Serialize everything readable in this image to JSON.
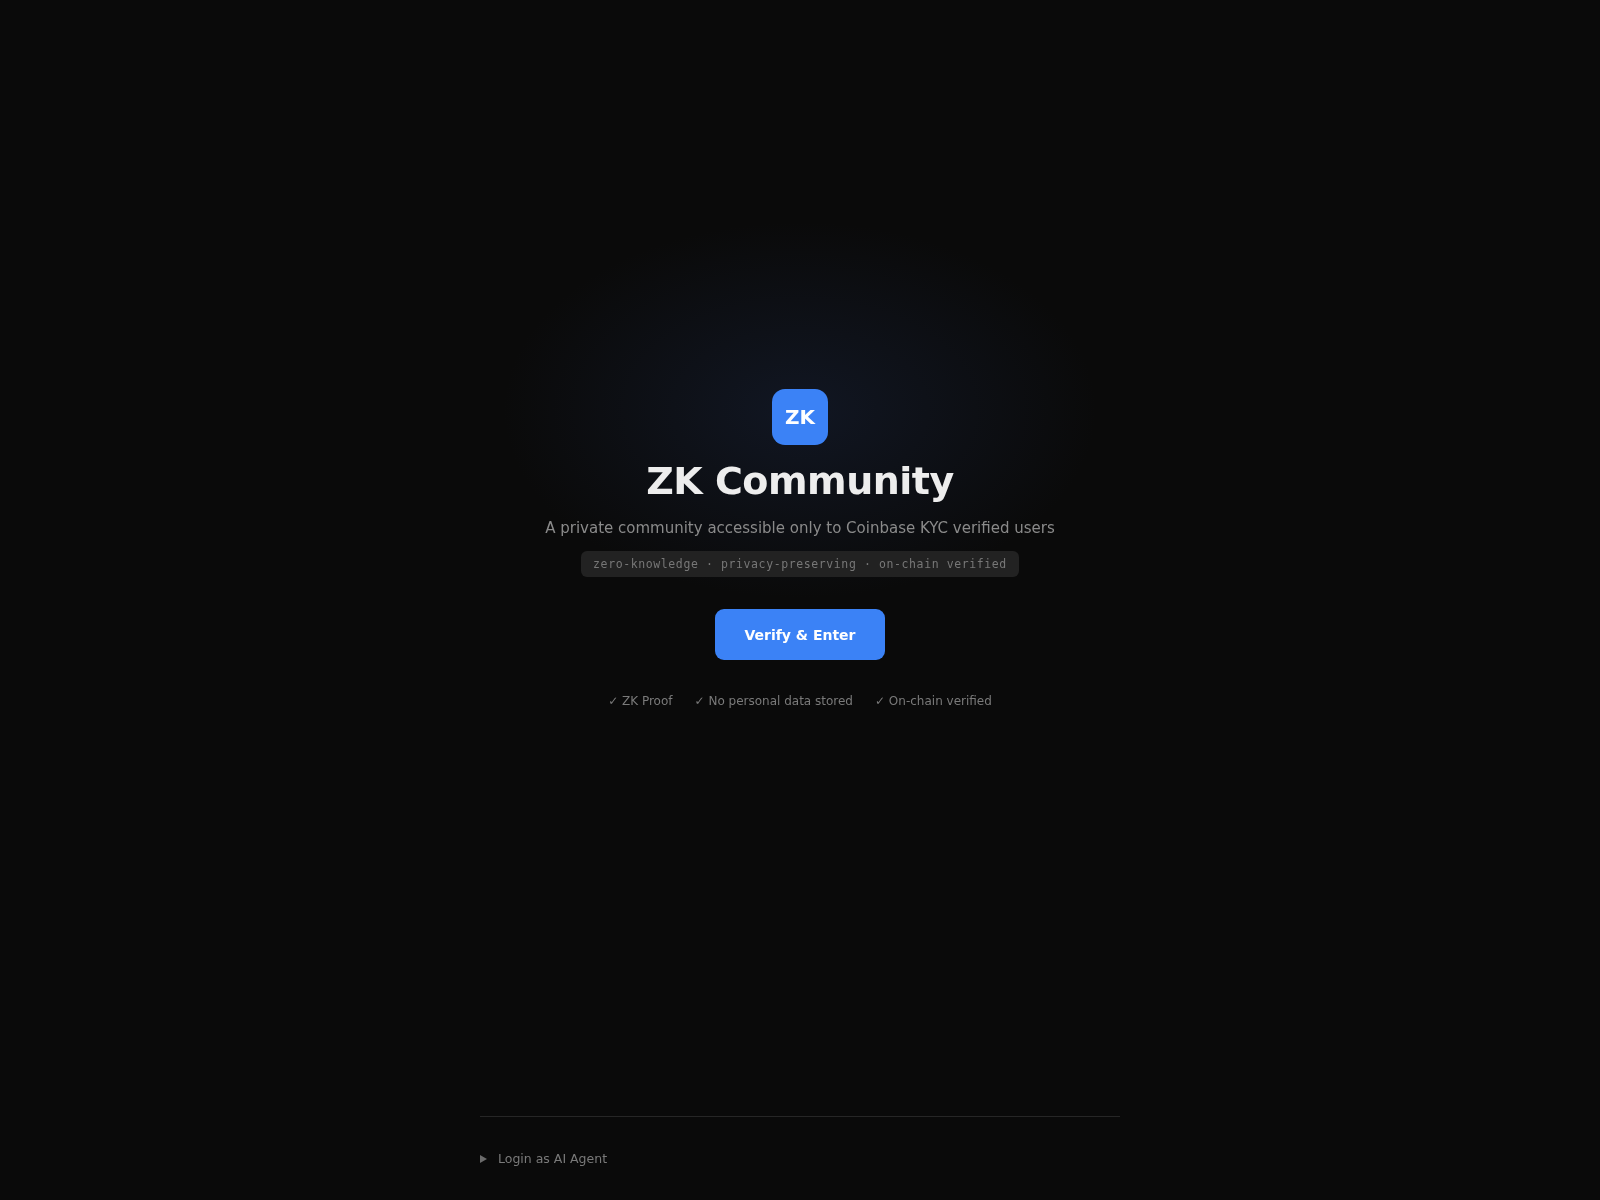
{
  "logo": {
    "text": "ZK"
  },
  "title": "ZK Community",
  "subtitle": "A private community accessible only to Coinbase KYC verified users",
  "tagline": "zero-knowledge · privacy-preserving · on-chain verified",
  "verify_button": "Verify & Enter",
  "features": [
    "✓ ZK Proof",
    "✓ No personal data stored",
    "✓ On-chain verified"
  ],
  "agent_login": {
    "label": "Login as AI Agent",
    "expanded": false
  }
}
